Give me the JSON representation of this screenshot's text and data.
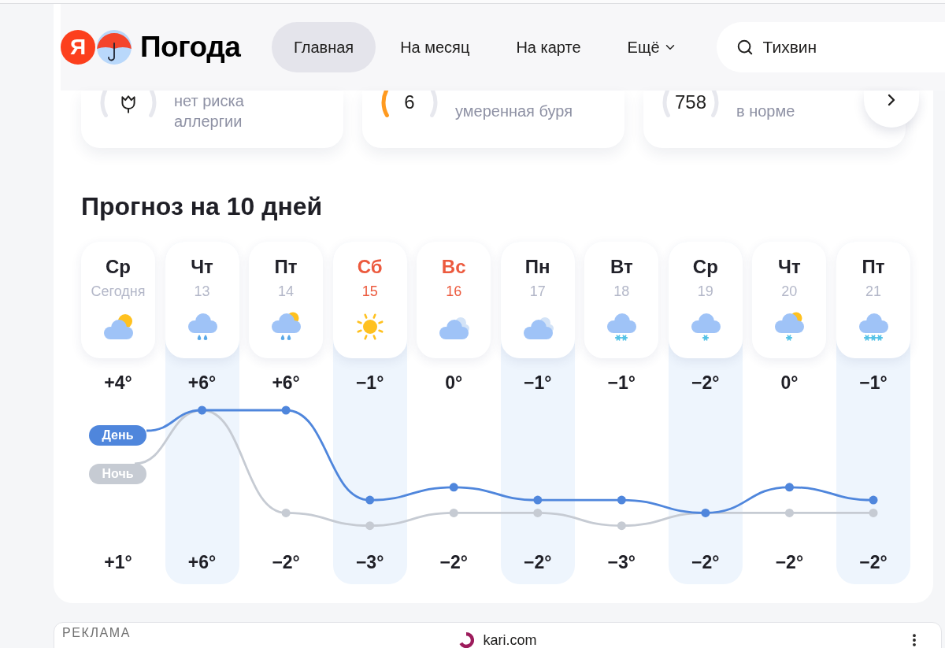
{
  "header": {
    "logo": {
      "letter": "Я",
      "name": "Погода"
    },
    "nav": [
      {
        "label": "Главная",
        "kind": "link",
        "selected": true
      },
      {
        "label": "На месяц",
        "kind": "link",
        "selected": false
      },
      {
        "label": "На карте",
        "kind": "link",
        "selected": false
      },
      {
        "label": "Ещё",
        "kind": "menu",
        "selected": false
      }
    ],
    "search": {
      "value": "Тихвин"
    }
  },
  "conditions": [
    {
      "kind": "icon",
      "status": "нет риска\nаллергии",
      "color": "#e7e8ee"
    },
    {
      "kind": "value",
      "value": "6",
      "status": "умеренная буря",
      "color": "#ff9a1f"
    },
    {
      "kind": "value",
      "value": "758",
      "status": "в норме",
      "color": "#e7e8ee"
    }
  ],
  "forecast": {
    "title": "Прогноз на 10 дней",
    "days": [
      {
        "name": "Ср",
        "date": "Сегодня",
        "weekend": false,
        "kind": "partlycloudy",
        "day_temp": "+4°",
        "night_temp": "+1°"
      },
      {
        "name": "Чт",
        "date": "13",
        "weekend": false,
        "kind": "rain",
        "day_temp": "+6°",
        "night_temp": "+6°"
      },
      {
        "name": "Пт",
        "date": "14",
        "weekend": false,
        "kind": "showers",
        "day_temp": "+6°",
        "night_temp": "−2°"
      },
      {
        "name": "Сб",
        "date": "15",
        "weekend": true,
        "kind": "clear",
        "day_temp": "−1°",
        "night_temp": "−3°"
      },
      {
        "name": "Вс",
        "date": "16",
        "weekend": true,
        "kind": "cloudy",
        "day_temp": "0°",
        "night_temp": "−2°"
      },
      {
        "name": "Пн",
        "date": "17",
        "weekend": false,
        "kind": "cloudy",
        "day_temp": "−1°",
        "night_temp": "−2°"
      },
      {
        "name": "Вт",
        "date": "18",
        "weekend": false,
        "kind": "snow",
        "day_temp": "−1°",
        "night_temp": "−3°"
      },
      {
        "name": "Ср",
        "date": "19",
        "weekend": false,
        "kind": "lightsnow",
        "day_temp": "−2°",
        "night_temp": "−2°"
      },
      {
        "name": "Чт",
        "date": "20",
        "weekend": false,
        "kind": "snowshowers",
        "day_temp": "0°",
        "night_temp": "−2°"
      },
      {
        "name": "Пт",
        "date": "21",
        "weekend": false,
        "kind": "heavysnow",
        "day_temp": "−1°",
        "night_temp": "−2°"
      }
    ],
    "legend": [
      {
        "label": "День",
        "color": "#4f86dc"
      },
      {
        "label": "Ночь",
        "color": "#c6cbd3"
      }
    ]
  },
  "ad": {
    "label": "РЕКЛАМА",
    "brand": "kari.com"
  }
}
